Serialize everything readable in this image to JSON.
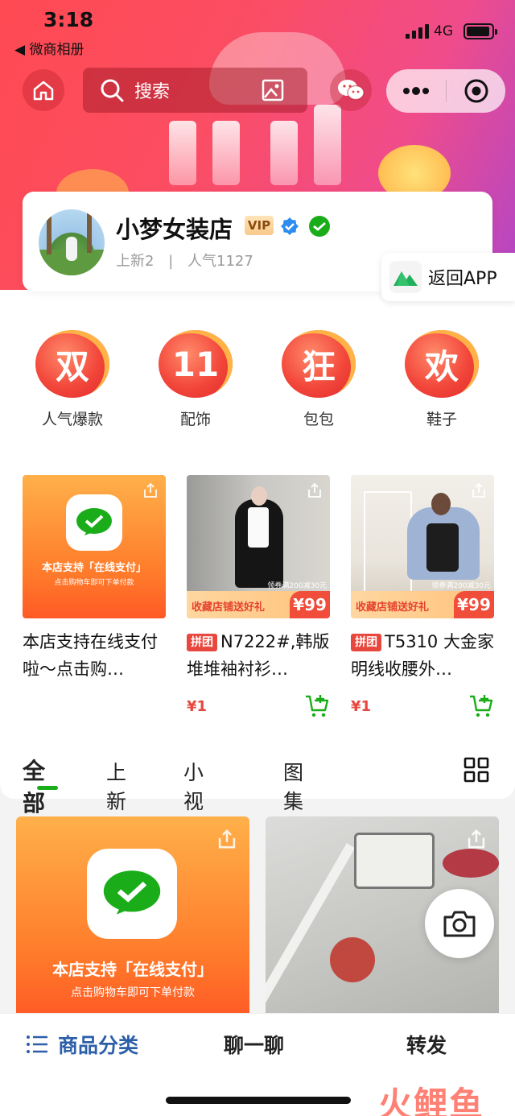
{
  "status_bar": {
    "time": "3:18",
    "back_label": "◀ 微商相册",
    "network": "4G"
  },
  "nav": {
    "search_placeholder": "搜索"
  },
  "shop": {
    "name": "小梦女装店",
    "vip_label": "VIP",
    "new_label": "上新2",
    "popularity_label": "人气1127",
    "separator": "|"
  },
  "return_app": {
    "label": "返回APP"
  },
  "categories": [
    {
      "icon_char": "双",
      "label": "人气爆款"
    },
    {
      "icon_char": "11",
      "label": "配饰"
    },
    {
      "icon_char": "狂",
      "label": "包包"
    },
    {
      "icon_char": "欢",
      "label": "鞋子"
    }
  ],
  "products": [
    {
      "title": "本店支持在线支付啦～点击购…",
      "tag": "",
      "price": "",
      "banner_line1": "本店支持「在线支付」",
      "banner_line2": "点击购物车即可下单付款"
    },
    {
      "title": "N7222#,韩版堆堆袖衬衫…",
      "tag": "拼团",
      "price": "¥1",
      "promo_text": "收藏店铺送好礼",
      "promo_price": "¥99",
      "promo_top": "领券满200减30元"
    },
    {
      "title": "T5310 大金家明线收腰外…",
      "tag": "拼团",
      "price": "¥1",
      "promo_text": "收藏店铺送好礼",
      "promo_price": "¥99",
      "promo_top": "领券满200减30元"
    }
  ],
  "tabs": [
    {
      "label": "全部",
      "active": true
    },
    {
      "label": "上新",
      "active": false
    },
    {
      "label": "小视频",
      "active": false
    },
    {
      "label": "图集",
      "active": false
    }
  ],
  "feed": {
    "banner_line1": "本店支持「在线支付」",
    "banner_line2": "点击购物车即可下单付款"
  },
  "bottom_bar": {
    "category_label": "商品分类",
    "chat_label": "聊一聊",
    "forward_label": "转发"
  },
  "watermark": "火鲤鱼",
  "colors": {
    "brand_green": "#1aad19",
    "accent_red": "#e8473e",
    "header_red": "#ff4a52",
    "header_purple": "#b246c8"
  }
}
